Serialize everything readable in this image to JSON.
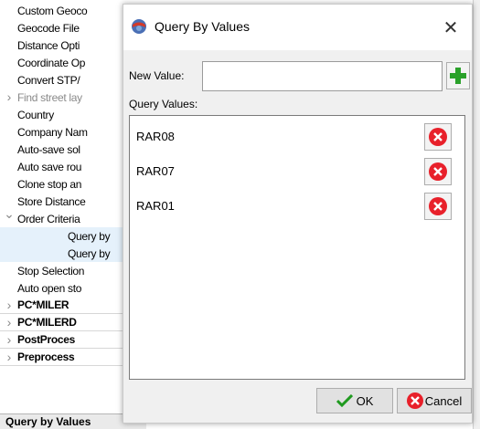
{
  "background_tree": {
    "items": [
      {
        "label": "Custom Geoco",
        "arrow": "",
        "indent": 0,
        "style": "normal"
      },
      {
        "label": "Geocode File",
        "arrow": "",
        "indent": 0,
        "style": "normal"
      },
      {
        "label": "Distance Opti",
        "arrow": "",
        "indent": 0,
        "style": "normal"
      },
      {
        "label": "Coordinate Op",
        "arrow": "",
        "indent": 0,
        "style": "normal"
      },
      {
        "label": "Convert STP/",
        "arrow": "",
        "indent": 0,
        "style": "normal"
      },
      {
        "label": "Find street lay",
        "arrow": ">",
        "indent": 0,
        "style": "grey"
      },
      {
        "label": "Country",
        "arrow": "",
        "indent": 0,
        "style": "normal"
      },
      {
        "label": "Company Nam",
        "arrow": "",
        "indent": 0,
        "style": "normal"
      },
      {
        "label": "Auto-save sol",
        "arrow": "",
        "indent": 0,
        "style": "normal"
      },
      {
        "label": "Auto save rou",
        "arrow": "",
        "indent": 0,
        "style": "normal"
      },
      {
        "label": "Clone stop an",
        "arrow": "",
        "indent": 0,
        "style": "normal"
      },
      {
        "label": "Store Distance",
        "arrow": "",
        "indent": 0,
        "style": "normal"
      },
      {
        "label": "Order Criteria",
        "arrow": "v",
        "indent": 0,
        "style": "normal"
      },
      {
        "label": "Query by",
        "arrow": "",
        "indent": 1,
        "style": "sel"
      },
      {
        "label": "Query by",
        "arrow": "",
        "indent": 1,
        "style": "sel"
      },
      {
        "label": "Stop Selection",
        "arrow": "",
        "indent": 0,
        "style": "normal"
      },
      {
        "label": "Auto open sto",
        "arrow": "",
        "indent": 0,
        "style": "normal"
      },
      {
        "label": "PC*MILER",
        "arrow": ">",
        "indent": 0,
        "style": "bold"
      },
      {
        "label": "PC*MILERD",
        "arrow": ">",
        "indent": 0,
        "style": "bold"
      },
      {
        "label": "PostProces",
        "arrow": ">",
        "indent": 0,
        "style": "bold"
      },
      {
        "label": "Preprocess",
        "arrow": ">",
        "indent": 0,
        "style": "bold"
      }
    ],
    "status_text": "Query by Values"
  },
  "dialog": {
    "title": "Query By Values",
    "close_symbol": "✕",
    "new_value_label": "New Value:",
    "new_value": "",
    "query_values_label": "Query Values:",
    "values": [
      "RAR08",
      "RAR07",
      "RAR01"
    ],
    "ok_label": "OK",
    "cancel_label": "Cancel",
    "icons": {
      "app": "globe-app-icon",
      "add": "plus-icon",
      "remove": "red-x-icon",
      "ok": "checkmark-icon",
      "cancel": "red-x-icon"
    }
  },
  "colors": {
    "add_green": "#2aa12a",
    "remove_red": "#e8202a",
    "check_green": "#1f9a1f",
    "selection_bg": "#e5f1fb"
  }
}
